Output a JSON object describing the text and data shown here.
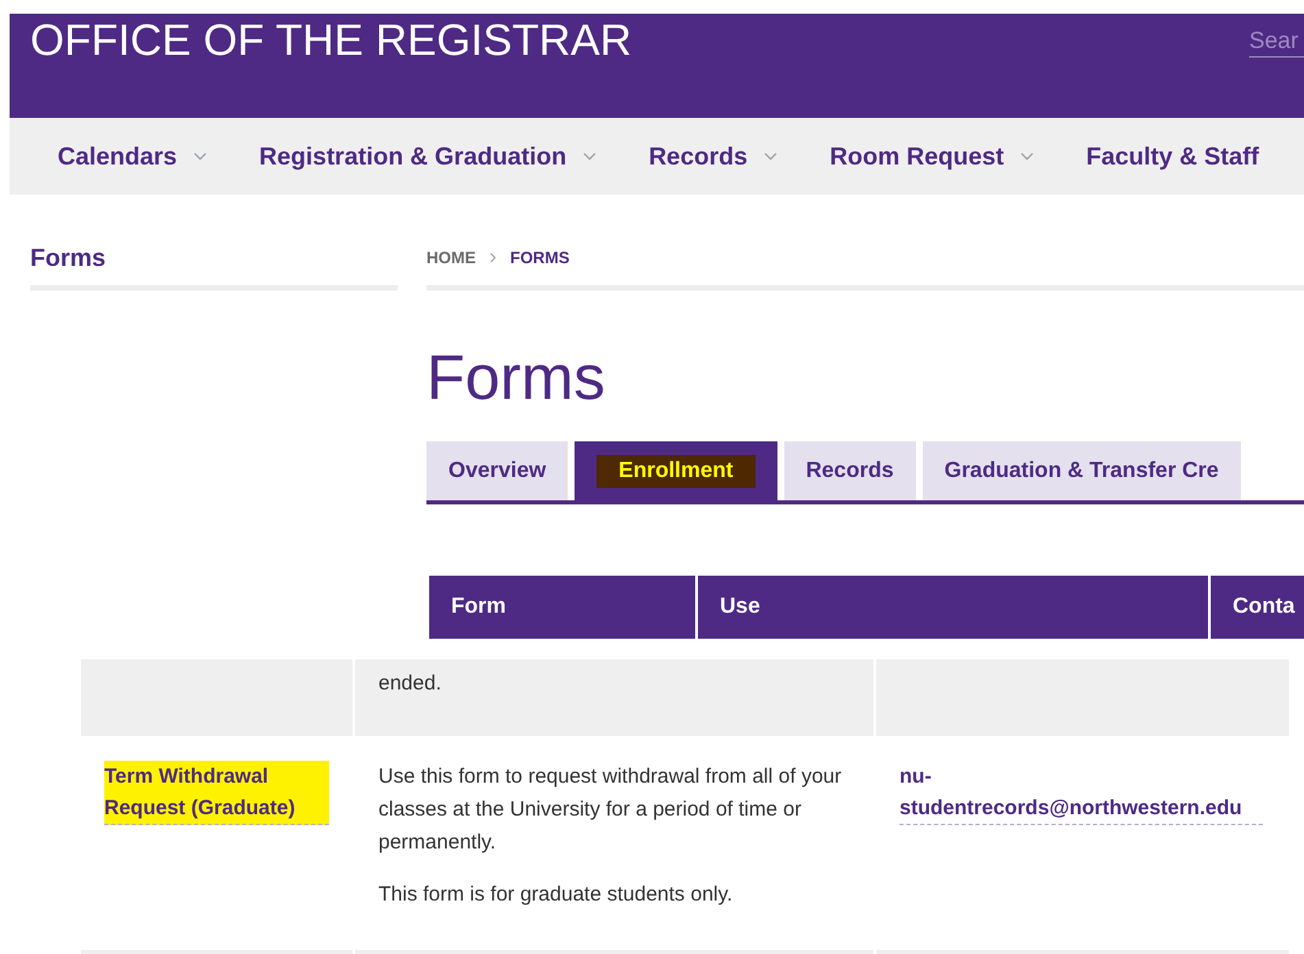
{
  "header": {
    "title": "OFFICE OF THE REGISTRAR",
    "search": {
      "placeholder": "Sear"
    }
  },
  "nav": [
    {
      "label": "Calendars",
      "caret": true
    },
    {
      "label": "Registration & Graduation",
      "caret": true
    },
    {
      "label": "Records",
      "caret": true
    },
    {
      "label": "Room Request",
      "caret": true
    },
    {
      "label": "Faculty & Staff",
      "caret": false
    }
  ],
  "sidebar": {
    "title": "Forms"
  },
  "breadcrumb": [
    {
      "label": "HOME",
      "current": false
    },
    {
      "label": "FORMS",
      "current": true
    }
  ],
  "page_title": "Forms",
  "tabs": [
    {
      "label": "Overview",
      "selected": false,
      "highlighted": false
    },
    {
      "label": "Enrollment",
      "selected": true,
      "highlighted": true
    },
    {
      "label": "Records",
      "selected": false,
      "highlighted": false
    },
    {
      "label": "Graduation & Transfer Cre",
      "selected": false,
      "highlighted": false
    }
  ],
  "table": {
    "columns": [
      "Form",
      "Use",
      "Conta"
    ],
    "rows": [
      {
        "shaded": true,
        "form": "",
        "use": [
          "ended."
        ],
        "contact": ""
      },
      {
        "shaded": false,
        "form": "Term Withdrawal Request (Graduate)",
        "form_highlighted": true,
        "use": [
          "Use this form to request withdrawal from all of your classes at the University for a period of time or permanently.",
          "This form is for graduate students only."
        ],
        "contact": "nu-studentrecords@northwestern.edu"
      },
      {
        "shaded": true,
        "form": "",
        "use": [],
        "contact": ""
      }
    ]
  }
}
